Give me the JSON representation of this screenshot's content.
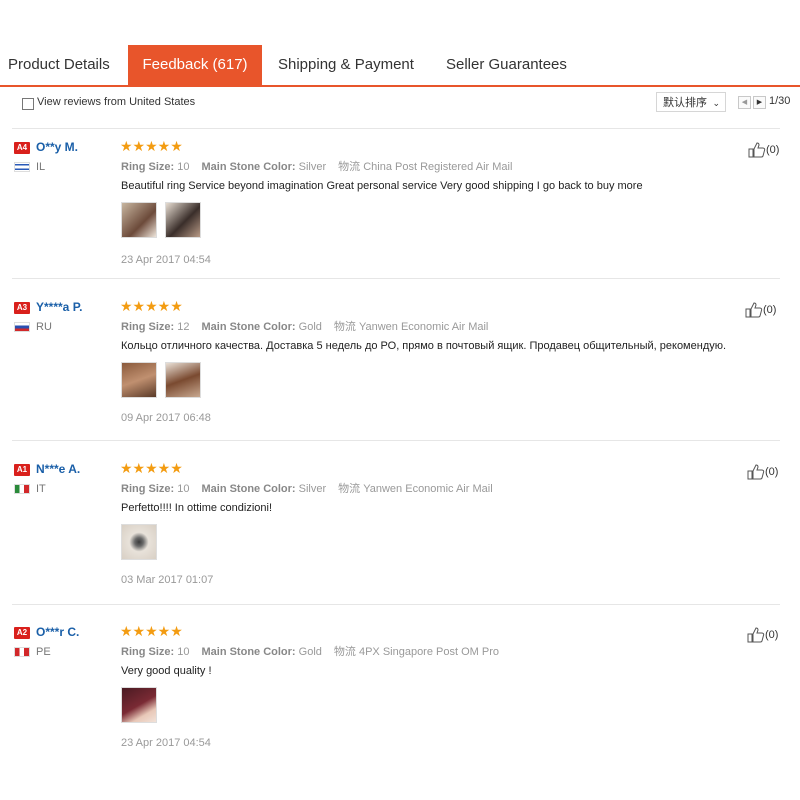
{
  "tabs": [
    {
      "label": "Product Details",
      "active": false
    },
    {
      "label": "Feedback (617)",
      "active": true
    },
    {
      "label": "Shipping & Payment",
      "active": false
    },
    {
      "label": "Seller Guarantees",
      "active": false
    }
  ],
  "filter": {
    "label": "View reviews from United States",
    "checked": false
  },
  "sort": {
    "selected": "默认排序"
  },
  "pagination": {
    "text": "1/30"
  },
  "reviews": [
    {
      "badge": "A4",
      "name": "O**y M.",
      "country": "IL",
      "rating": 5,
      "stars": "★★★★★",
      "ring_size_label": "Ring Size:",
      "ring_size": "10",
      "stone_label": "Main Stone Color:",
      "stone": "Silver",
      "logistics_label": "物流",
      "logistics": "China Post Registered Air Mail",
      "text": "Beautiful ring Service beyond imagination Great personal service Very good shipping I go back to buy more",
      "date": "23 Apr 2017 04:54",
      "likes": "(0)",
      "image_count": 2
    },
    {
      "badge": "A3",
      "name": "Y****a P.",
      "country": "RU",
      "rating": 5,
      "stars": "★★★★★",
      "ring_size_label": "Ring Size:",
      "ring_size": "12",
      "stone_label": "Main Stone Color:",
      "stone": "Gold",
      "logistics_label": "物流",
      "logistics": "Yanwen Economic Air Mail",
      "text": "Кольцо отличного качества. Доставка 5 недель до РО, прямо в почтовый ящик. Продавец общительный, рекомендую.",
      "date": "09 Apr 2017 06:48",
      "likes": "(0)",
      "image_count": 2
    },
    {
      "badge": "A1",
      "name": "N***e A.",
      "country": "IT",
      "rating": 5,
      "stars": "★★★★★",
      "ring_size_label": "Ring Size:",
      "ring_size": "10",
      "stone_label": "Main Stone Color:",
      "stone": "Silver",
      "logistics_label": "物流",
      "logistics": "Yanwen Economic Air Mail",
      "text": "Perfetto!!!! In ottime condizioni!",
      "date": "03 Mar 2017 01:07",
      "likes": "(0)",
      "image_count": 1
    },
    {
      "badge": "A2",
      "name": "O***r C.",
      "country": "PE",
      "rating": 5,
      "stars": "★★★★★",
      "ring_size_label": "Ring Size:",
      "ring_size": "10",
      "stone_label": "Main Stone Color:",
      "stone": "Gold",
      "logistics_label": "物流",
      "logistics": "4PX Singapore Post OM Pro",
      "text": "Very good quality !",
      "date": "23 Apr 2017 04:54",
      "likes": "(0)",
      "image_count": 1
    }
  ],
  "colors": {
    "accent": "#e8552b",
    "star": "#f39c12",
    "badge": "#d9201c",
    "username": "#1a5fa8"
  },
  "icons": {
    "like": "thumbs-up-icon",
    "prev": "chevron-left-icon",
    "next": "chevron-right-icon"
  }
}
